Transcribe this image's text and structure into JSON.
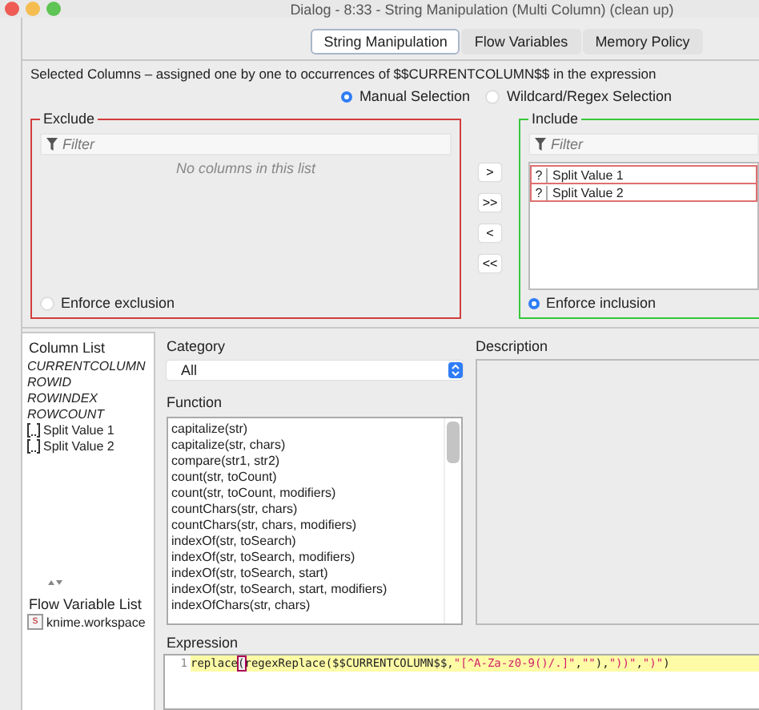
{
  "window": {
    "title": "Dialog - 8:33 - String Manipulation (Multi Column) (clean up)"
  },
  "tabs": [
    {
      "label": "String Manipulation",
      "selected": true
    },
    {
      "label": "Flow Variables",
      "selected": false
    },
    {
      "label": "Memory Policy",
      "selected": false
    }
  ],
  "column_selection": {
    "title": "Selected Columns – assigned one by one to occurrences of $$CURRENTCOLUMN$$ in the expression",
    "modes": [
      {
        "label": "Manual Selection",
        "selected": true
      },
      {
        "label": "Wildcard/Regex Selection",
        "selected": false
      }
    ],
    "exclude": {
      "title": "Exclude",
      "filter_placeholder": "Filter",
      "empty_message": "No columns in this list",
      "enforce": {
        "label": "Enforce exclusion",
        "selected": false
      }
    },
    "move_buttons": [
      ">",
      ">>",
      "<",
      "<<"
    ],
    "include": {
      "title": "Include",
      "filter_placeholder": "Filter",
      "items": [
        {
          "type_icon": "?",
          "label": "Split Value 1"
        },
        {
          "type_icon": "?",
          "label": "Split Value 2"
        }
      ],
      "enforce": {
        "label": "Enforce inclusion",
        "selected": true
      }
    }
  },
  "column_list": {
    "title": "Column List",
    "items": [
      {
        "kind": "variable",
        "label": "CURRENTCOLUMN"
      },
      {
        "kind": "variable",
        "label": "ROWID"
      },
      {
        "kind": "variable",
        "label": "ROWINDEX"
      },
      {
        "kind": "variable",
        "label": "ROWCOUNT"
      },
      {
        "kind": "column",
        "label": "Split Value 1"
      },
      {
        "kind": "column",
        "label": "Split Value 2"
      }
    ]
  },
  "flow_variable_list": {
    "title": "Flow Variable List",
    "items": [
      {
        "type_icon": "s",
        "label": "knime.workspace"
      }
    ]
  },
  "category": {
    "label": "Category",
    "value": "All"
  },
  "function": {
    "label": "Function",
    "items": [
      "capitalize(str)",
      "capitalize(str, chars)",
      "compare(str1, str2)",
      "count(str, toCount)",
      "count(str, toCount, modifiers)",
      "countChars(str, chars)",
      "countChars(str, chars, modifiers)",
      "indexOf(str, toSearch)",
      "indexOf(str, toSearch, modifiers)",
      "indexOf(str, toSearch, start)",
      "indexOf(str, toSearch, start, modifiers)",
      "indexOfChars(str, chars)"
    ]
  },
  "description": {
    "label": "Description"
  },
  "expression": {
    "label": "Expression",
    "line_number": "1",
    "tokens": [
      {
        "kind": "plain",
        "text": "replace"
      },
      {
        "kind": "match",
        "text": "("
      },
      {
        "kind": "plain",
        "text": "regexReplace"
      },
      {
        "kind": "plain",
        "text": "($$CURRENTCOLUMN$$,"
      },
      {
        "kind": "string",
        "text": "\"[^A-Za-z0-9()/.]\""
      },
      {
        "kind": "plain",
        "text": ","
      },
      {
        "kind": "string",
        "text": "\"\""
      },
      {
        "kind": "plain",
        "text": "),"
      },
      {
        "kind": "string",
        "text": "\"))\""
      },
      {
        "kind": "plain",
        "text": ","
      },
      {
        "kind": "string",
        "text": "\")\""
      },
      {
        "kind": "plain",
        "text": ")"
      }
    ]
  }
}
